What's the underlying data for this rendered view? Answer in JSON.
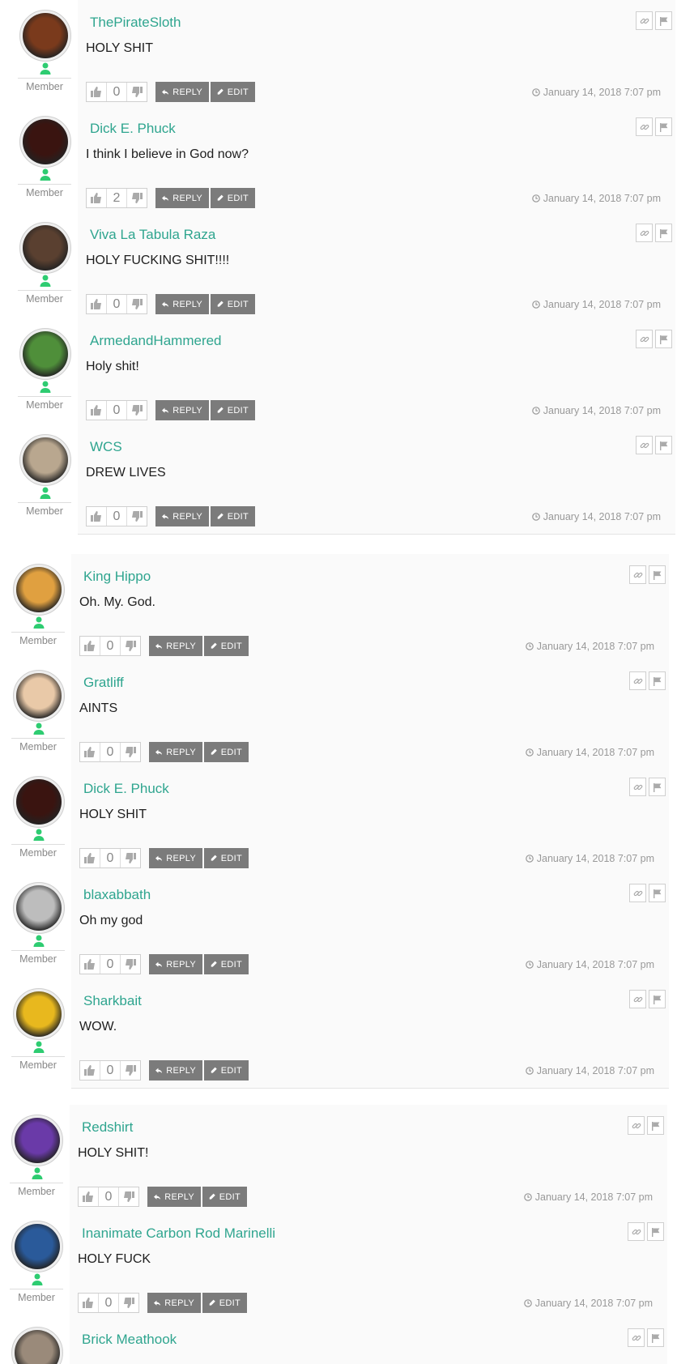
{
  "role_label": "Member",
  "reply_label": "REPLY",
  "edit_label": "EDIT",
  "colors": {
    "name": "#2fa58f",
    "button": "#7b7b7b",
    "online": "#2ecc71"
  },
  "segments": [
    {
      "comments": [
        {
          "author": "ThePirateSloth",
          "text": "HOLY SHIT",
          "votes": "0",
          "date": "January 14, 2018 7:07 pm",
          "avatar": "#7a3a1c"
        },
        {
          "author": "Dick E. Phuck",
          "text": "I think I believe in God now?",
          "votes": "2",
          "date": "January 14, 2018 7:07 pm",
          "avatar": "#3a1410"
        },
        {
          "author": "Viva La Tabula Raza",
          "text": "HOLY FUCKING SHIT!!!!",
          "votes": "0",
          "date": "January 14, 2018 7:07 pm",
          "avatar": "#5a4030"
        },
        {
          "author": "ArmedandHammered",
          "text": "Holy shit!",
          "votes": "0",
          "date": "January 14, 2018 7:07 pm",
          "avatar": "#4f8f3a"
        },
        {
          "author": "WCS",
          "text": "DREW LIVES",
          "votes": "0",
          "date": "January 14, 2018 7:07 pm",
          "avatar": "#b9a78f"
        }
      ]
    },
    {
      "comments": [
        {
          "author": "King Hippo",
          "text": "Oh. My. God.",
          "votes": "0",
          "date": "January 14, 2018 7:07 pm",
          "avatar": "#e0a040"
        },
        {
          "author": "Gratliff",
          "text": "AINTS",
          "votes": "0",
          "date": "January 14, 2018 7:07 pm",
          "avatar": "#e9c9a8"
        },
        {
          "author": "Dick E. Phuck",
          "text": "HOLY SHIT",
          "votes": "0",
          "date": "January 14, 2018 7:07 pm",
          "avatar": "#3a1410"
        },
        {
          "author": "blaxabbath",
          "text": "Oh my god",
          "votes": "0",
          "date": "January 14, 2018 7:07 pm",
          "avatar": "#bdbdbd"
        },
        {
          "author": "Sharkbait",
          "text": "WOW.",
          "votes": "0",
          "date": "January 14, 2018 7:07 pm",
          "avatar": "#e8b81e"
        }
      ]
    },
    {
      "comments": [
        {
          "author": "Redshirt",
          "text": "HOLY SHIT!",
          "votes": "0",
          "date": "January 14, 2018 7:07 pm",
          "avatar": "#6a3aa8"
        },
        {
          "author": "Inanimate Carbon Rod Marinelli",
          "text": "HOLY FUCK",
          "votes": "0",
          "date": "January 14, 2018 7:07 pm",
          "avatar": "#2a5a9a"
        },
        {
          "author": "Brick Meathook",
          "text": "",
          "votes": "",
          "date": "",
          "avatar": "#9a8a7a"
        }
      ]
    }
  ]
}
